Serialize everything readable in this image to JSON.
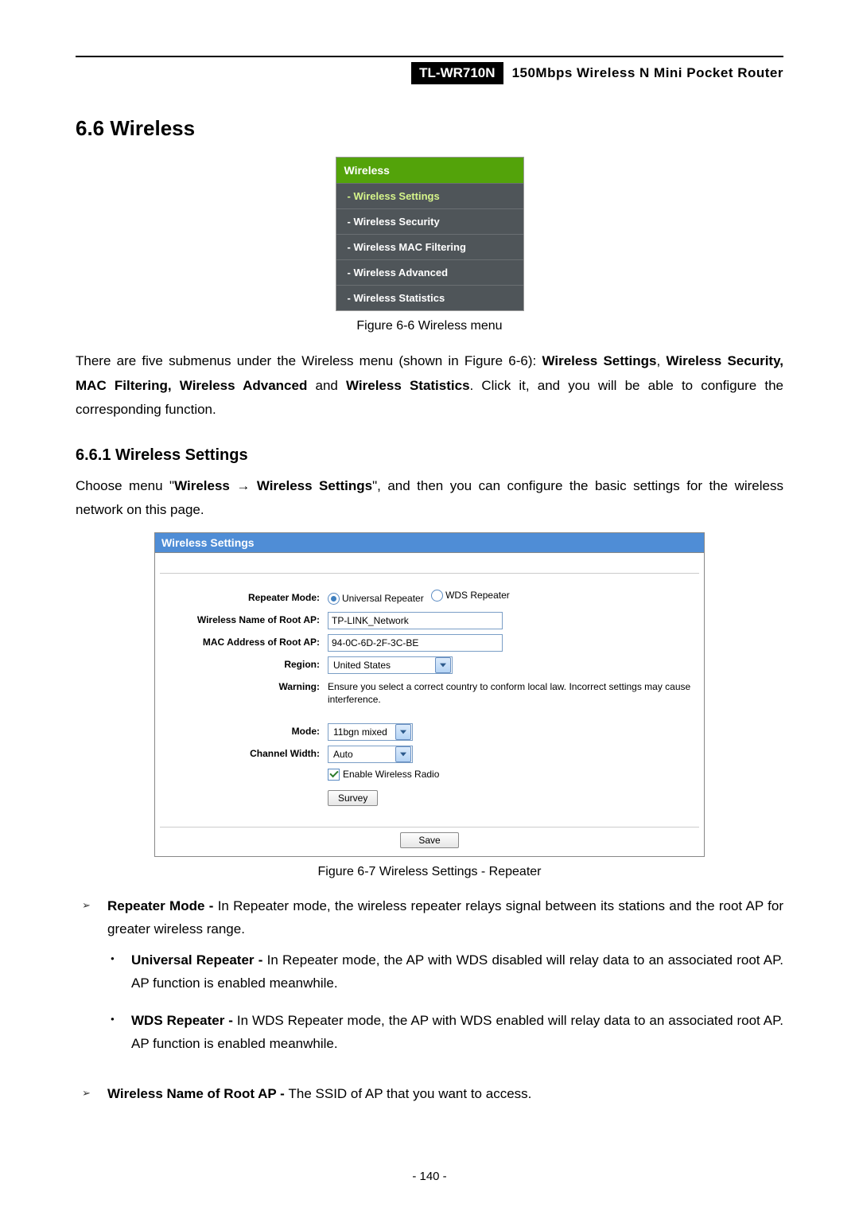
{
  "header": {
    "model": "TL-WR710N",
    "product": "150Mbps Wireless N Mini Pocket Router"
  },
  "section": {
    "title": "6.6  Wireless",
    "subtitle": "6.6.1  Wireless Settings"
  },
  "menu": {
    "title": "Wireless",
    "items": [
      "- Wireless Settings",
      "- Wireless Security",
      "- Wireless MAC Filtering",
      "- Wireless Advanced",
      "- Wireless Statistics"
    ]
  },
  "figures": {
    "menu_caption": "Figure 6-6    Wireless menu",
    "panel_caption": "Figure 6-7 Wireless Settings - Repeater"
  },
  "text": {
    "intro_a": "There are five submenus under the Wireless menu (shown in Figure 6-6): ",
    "intro_bold_a": "Wireless Settings",
    "intro_b": ", ",
    "intro_bold_b": "Wireless Security, MAC Filtering, Wireless Advanced",
    "intro_c": " and ",
    "intro_bold_c": "Wireless Statistics",
    "intro_d": ". Click it, and you will be able to configure the corresponding function.",
    "sub_a": "Choose menu \"",
    "sub_bold_a": "Wireless",
    "sub_arrow": "  →  ",
    "sub_bold_b": "Wireless Settings",
    "sub_b": "\", and then you can configure the basic settings for the wireless network on this page."
  },
  "panel": {
    "title": "Wireless Settings",
    "labels": {
      "repeater_mode": "Repeater Mode:",
      "wname_root": "Wireless Name of Root AP:",
      "mac_root": "MAC Address of Root AP:",
      "region": "Region:",
      "warning": "Warning:",
      "mode": "Mode:",
      "channel_width": "Channel Width:"
    },
    "values": {
      "radio_universal": "Universal Repeater",
      "radio_wds": "WDS Repeater",
      "wname_root": "TP-LINK_Network",
      "mac_root": "94-0C-6D-2F-3C-BE",
      "region": "United States",
      "warning": "Ensure you select a correct country to conform local law. Incorrect settings may cause interference.",
      "mode": "11bgn mixed",
      "channel_width": "Auto",
      "enable_radio": "Enable Wireless Radio",
      "survey": "Survey",
      "save": "Save"
    }
  },
  "bullets": {
    "b1_bold": "Repeater Mode - ",
    "b1": "In Repeater mode, the wireless repeater relays signal between its stations and the root AP for greater wireless range.",
    "b1a_bold": "Universal Repeater - ",
    "b1a": "In Repeater mode, the AP with WDS disabled will relay data to an associated root AP. AP function is enabled meanwhile.",
    "b1b_bold": "WDS Repeater - ",
    "b1b": "In WDS Repeater mode, the AP with WDS enabled will relay data to an associated root AP. AP function is enabled meanwhile.",
    "b2_bold": "Wireless Name of Root AP - ",
    "b2": "The SSID of AP that you want to access."
  },
  "page_number": "- 140 -"
}
